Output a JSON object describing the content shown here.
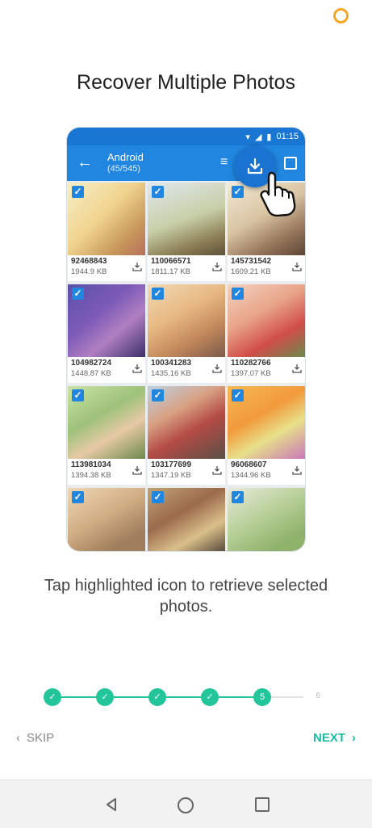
{
  "header": {
    "title": "Recover Multiple Photos"
  },
  "phone": {
    "status": {
      "time": "01:15"
    },
    "appbar": {
      "title": "Android",
      "subtitle": "(45/545)"
    },
    "photos": [
      {
        "name": "92468843",
        "size": "1944.9 KB"
      },
      {
        "name": "110066571",
        "size": "1811.17 KB"
      },
      {
        "name": "145731542",
        "size": "1609.21 KB"
      },
      {
        "name": "104982724",
        "size": "1448.87 KB"
      },
      {
        "name": "100341283",
        "size": "1435.16 KB"
      },
      {
        "name": "110282766",
        "size": "1397.07 KB"
      },
      {
        "name": "113981034",
        "size": "1394.38 KB"
      },
      {
        "name": "103177699",
        "size": "1347.19 KB"
      },
      {
        "name": "96068607",
        "size": "1344.96 KB"
      }
    ]
  },
  "caption": {
    "text": "Tap highlighted icon to retrieve selected photos."
  },
  "stepper": {
    "current": "5",
    "last": "6"
  },
  "footer": {
    "skip_label": "SKIP",
    "next_label": "NEXT"
  },
  "colors": {
    "accent": "#23c69a",
    "app_blue": "#2086df",
    "next": "#19c0a0"
  }
}
